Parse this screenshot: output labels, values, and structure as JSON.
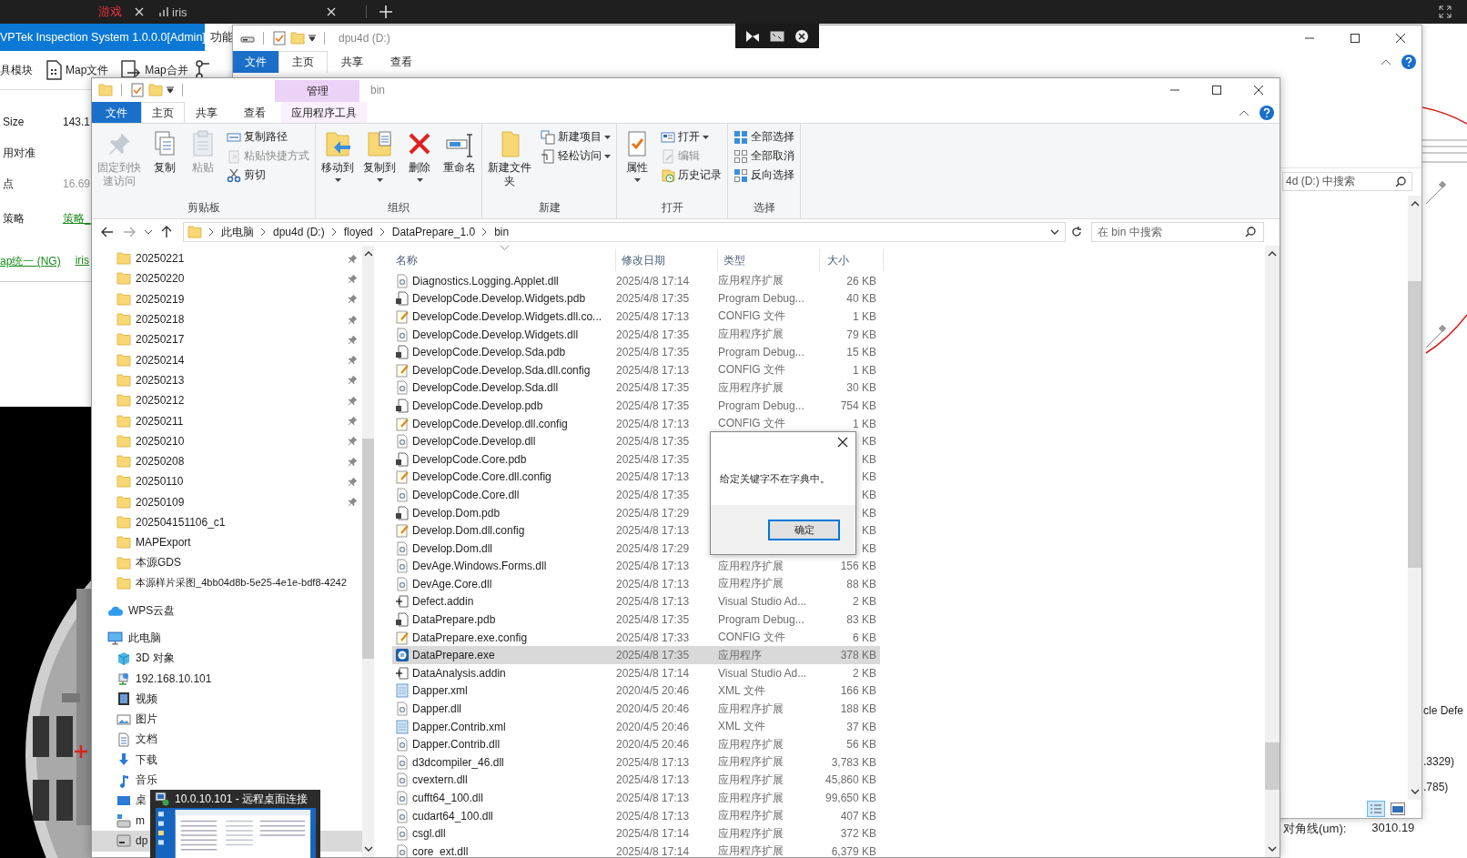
{
  "browser_tabs": [
    {
      "label": "游戏",
      "kind": "plain",
      "color": "#e8343c"
    },
    {
      "label": "iris",
      "kind": "signal",
      "color": "#c8c8c8"
    }
  ],
  "vptek": {
    "title": "VPTek Inspection System 1.0.0.0[Admin]",
    "menu_item": "功能",
    "toolbar": [
      {
        "label": "具模块",
        "kind": "text"
      },
      {
        "label": "Map文件",
        "kind": "map-file"
      },
      {
        "label": "Map合并",
        "kind": "map-merge"
      }
    ],
    "fields": [
      {
        "label": "Size",
        "value": "143.1",
        "kind": "text"
      },
      {
        "label": "用对准"
      },
      {
        "label": "点",
        "value": "16.69",
        "kind": "disabled"
      },
      {
        "label": "策略",
        "value": "策略_",
        "kind": "link"
      }
    ],
    "links": [
      "ap统一 (NG)",
      "iris"
    ],
    "side_texts": [
      "cle Defe",
      ".3329)",
      ".785)"
    ],
    "diagonal": {
      "label": "对角线(um):",
      "value": "3010.19"
    }
  },
  "back_explorer": {
    "title": "dpu4d (D:)",
    "tabs": [
      {
        "label": "文件",
        "kind": "file",
        "selected": false
      },
      {
        "label": "主页",
        "kind": "tab",
        "selected": true
      },
      {
        "label": "共享",
        "kind": "tab",
        "selected": false
      },
      {
        "label": "查看",
        "kind": "tab",
        "selected": false
      }
    ],
    "search_placeholder": "4d (D:) 中搜索"
  },
  "explorer": {
    "title": "bin",
    "tool_group": "管理",
    "tabs": [
      {
        "label": "文件",
        "kind": "file",
        "selected": false
      },
      {
        "label": "主页",
        "kind": "tab",
        "selected": true
      },
      {
        "label": "共享",
        "kind": "tab",
        "selected": false
      },
      {
        "label": "查看",
        "kind": "tab",
        "selected": false
      },
      {
        "label": "应用程序工具",
        "kind": "tool",
        "selected": false
      }
    ],
    "ribbon": [
      {
        "label": "剪贴板",
        "buttons": [
          {
            "label": "固定到快速访问",
            "kind": "large",
            "disabled": true,
            "dropdown": false
          },
          {
            "label": "复制",
            "kind": "large",
            "disabled": false,
            "dropdown": false
          },
          {
            "label": "粘贴",
            "kind": "large",
            "disabled": true,
            "dropdown": false
          },
          {
            "label": "复制路径",
            "kind": "small",
            "disabled": false,
            "dropdown": false
          },
          {
            "label": "粘贴快捷方式",
            "kind": "small",
            "disabled": true,
            "dropdown": false
          },
          {
            "label": "剪切",
            "kind": "small",
            "disabled": false,
            "dropdown": false
          }
        ]
      },
      {
        "label": "组织",
        "buttons": [
          {
            "label": "移动到",
            "kind": "large",
            "disabled": false,
            "dropdown": true
          },
          {
            "label": "复制到",
            "kind": "large",
            "disabled": false,
            "dropdown": true
          },
          {
            "label": "删除",
            "kind": "large",
            "disabled": false,
            "dropdown": true
          },
          {
            "label": "重命名",
            "kind": "large",
            "disabled": false,
            "dropdown": false
          }
        ]
      },
      {
        "label": "新建",
        "buttons": [
          {
            "label": "新建文件夹",
            "kind": "large",
            "disabled": false,
            "dropdown": false
          },
          {
            "label": "新建项目",
            "kind": "small",
            "disabled": false,
            "dropdown": true
          },
          {
            "label": "轻松访问",
            "kind": "small",
            "disabled": false,
            "dropdown": true
          }
        ]
      },
      {
        "label": "打开",
        "buttons": [
          {
            "label": "属性",
            "kind": "large",
            "disabled": false,
            "dropdown": true
          },
          {
            "label": "打开",
            "kind": "small",
            "disabled": false,
            "dropdown": true
          },
          {
            "label": "编辑",
            "kind": "small",
            "disabled": true,
            "dropdown": false
          },
          {
            "label": "历史记录",
            "kind": "small",
            "disabled": false,
            "dropdown": false
          }
        ]
      },
      {
        "label": "选择",
        "buttons": [
          {
            "label": "全部选择",
            "kind": "small",
            "disabled": false,
            "dropdown": false
          },
          {
            "label": "全部取消",
            "kind": "small",
            "disabled": false,
            "dropdown": false
          },
          {
            "label": "反向选择",
            "kind": "small",
            "disabled": false,
            "dropdown": false
          }
        ]
      }
    ],
    "address": [
      "此电脑",
      "dpu4d (D:)",
      "floyed",
      "DataPrepare_1.0",
      "bin"
    ],
    "search_placeholder": "在 bin 中搜索",
    "quick_access": [
      {
        "label": "20250221",
        "pinned": true
      },
      {
        "label": "20250220",
        "pinned": true
      },
      {
        "label": "20250219",
        "pinned": true
      },
      {
        "label": "20250218",
        "pinned": true
      },
      {
        "label": "20250217",
        "pinned": true
      },
      {
        "label": "20250214",
        "pinned": true
      },
      {
        "label": "20250213",
        "pinned": true
      },
      {
        "label": "20250212",
        "pinned": true
      },
      {
        "label": "20250211",
        "pinned": true
      },
      {
        "label": "20250210",
        "pinned": true
      },
      {
        "label": "20250208",
        "pinned": true
      },
      {
        "label": "20250110",
        "pinned": true
      },
      {
        "label": "20250109",
        "pinned": true
      },
      {
        "label": "202504151106_c1",
        "pinned": false
      },
      {
        "label": "MAPExport",
        "pinned": false
      },
      {
        "label": "本源GDS",
        "pinned": false
      },
      {
        "label": "本源样片采图_4bb04d8b-5e25-4e1e-bdf8-4242",
        "pinned": false
      }
    ],
    "roots": [
      {
        "label": "WPS云盘",
        "kind": "cloud",
        "selected": false
      },
      {
        "label": "此电脑",
        "kind": "computer",
        "selected": false,
        "children": [
          {
            "label": "3D 对象",
            "kind": "cube",
            "selected": false
          },
          {
            "label": "192.168.10.101",
            "kind": "network",
            "selected": false
          },
          {
            "label": "视频",
            "kind": "video",
            "selected": false
          },
          {
            "label": "图片",
            "kind": "picture",
            "selected": false
          },
          {
            "label": "文档",
            "kind": "document",
            "selected": false
          },
          {
            "label": "下载",
            "kind": "download",
            "selected": false
          },
          {
            "label": "音乐",
            "kind": "music",
            "selected": false
          },
          {
            "label": "桌",
            "kind": "desktop",
            "selected": false
          },
          {
            "label": "m",
            "kind": "netdrive",
            "selected": false
          },
          {
            "label": "dp",
            "kind": "drive",
            "selected": true
          }
        ]
      }
    ],
    "columns": [
      "名称",
      "修改日期",
      "类型",
      "大小"
    ],
    "rows": [
      {
        "name": "Diagnostics.Logging.Applet.dll",
        "date": "2025/4/8 17:14",
        "type": "应用程序扩展",
        "size": "26 KB",
        "kind": "dll",
        "selected": false
      },
      {
        "name": "DevelopCode.Develop.Widgets.pdb",
        "date": "2025/4/8 17:35",
        "type": "Program Debug...",
        "size": "40 KB",
        "kind": "pdb",
        "selected": false
      },
      {
        "name": "DevelopCode.Develop.Widgets.dll.co...",
        "date": "2025/4/8 17:13",
        "type": "CONFIG 文件",
        "size": "1 KB",
        "kind": "config",
        "selected": false
      },
      {
        "name": "DevelopCode.Develop.Widgets.dll",
        "date": "2025/4/8 17:35",
        "type": "应用程序扩展",
        "size": "79 KB",
        "kind": "dll",
        "selected": false
      },
      {
        "name": "DevelopCode.Develop.Sda.pdb",
        "date": "2025/4/8 17:35",
        "type": "Program Debug...",
        "size": "15 KB",
        "kind": "pdb",
        "selected": false
      },
      {
        "name": "DevelopCode.Develop.Sda.dll.config",
        "date": "2025/4/8 17:13",
        "type": "CONFIG 文件",
        "size": "1 KB",
        "kind": "config",
        "selected": false
      },
      {
        "name": "DevelopCode.Develop.Sda.dll",
        "date": "2025/4/8 17:35",
        "type": "应用程序扩展",
        "size": "30 KB",
        "kind": "dll",
        "selected": false
      },
      {
        "name": "DevelopCode.Develop.pdb",
        "date": "2025/4/8 17:35",
        "type": "Program Debug...",
        "size": "754 KB",
        "kind": "pdb",
        "selected": false
      },
      {
        "name": "DevelopCode.Develop.dll.config",
        "date": "2025/4/8 17:13",
        "type": "CONFIG 文件",
        "size": "1 KB",
        "kind": "config",
        "selected": false
      },
      {
        "name": "DevelopCode.Develop.dll",
        "date": "2025/4/8 17:35",
        "size": "KB",
        "kind": "dll",
        "selected": false
      },
      {
        "name": "DevelopCode.Core.pdb",
        "date": "2025/4/8 17:35",
        "size": "KB",
        "kind": "pdb",
        "selected": false
      },
      {
        "name": "DevelopCode.Core.dll.config",
        "date": "2025/4/8 17:13",
        "size": "KB",
        "kind": "config",
        "selected": false
      },
      {
        "name": "DevelopCode.Core.dll",
        "date": "2025/4/8 17:35",
        "size": "KB",
        "kind": "dll",
        "selected": false
      },
      {
        "name": "Develop.Dom.pdb",
        "date": "2025/4/8 17:29",
        "size": "KB",
        "kind": "pdb",
        "selected": false
      },
      {
        "name": "Develop.Dom.dll.config",
        "date": "2025/4/8 17:13",
        "size": "KB",
        "kind": "config",
        "selected": false
      },
      {
        "name": "Develop.Dom.dll",
        "date": "2025/4/8 17:29",
        "size": "KB",
        "kind": "dll",
        "selected": false
      },
      {
        "name": "DevAge.Windows.Forms.dll",
        "date": "2025/4/8 17:13",
        "type": "应用程序扩展",
        "size": "156 KB",
        "kind": "dll",
        "selected": false
      },
      {
        "name": "DevAge.Core.dll",
        "date": "2025/4/8 17:13",
        "type": "应用程序扩展",
        "size": "88 KB",
        "kind": "dll",
        "selected": false
      },
      {
        "name": "Defect.addin",
        "date": "2025/4/8 17:13",
        "type": "Visual Studio Ad...",
        "size": "2 KB",
        "kind": "addin",
        "selected": false
      },
      {
        "name": "DataPrepare.pdb",
        "date": "2025/4/8 17:35",
        "type": "Program Debug...",
        "size": "83 KB",
        "kind": "pdb",
        "selected": false
      },
      {
        "name": "DataPrepare.exe.config",
        "date": "2025/4/8 17:33",
        "type": "CONFIG 文件",
        "size": "6 KB",
        "kind": "config",
        "selected": false
      },
      {
        "name": "DataPrepare.exe",
        "date": "2025/4/8 17:35",
        "type": "应用程序",
        "size": "378 KB",
        "kind": "exe",
        "selected": true
      },
      {
        "name": "DataAnalysis.addin",
        "date": "2025/4/8 17:14",
        "type": "Visual Studio Ad...",
        "size": "2 KB",
        "kind": "addin",
        "selected": false
      },
      {
        "name": "Dapper.xml",
        "date": "2020/4/5 20:46",
        "type": "XML 文件",
        "size": "166 KB",
        "kind": "xml",
        "selected": false
      },
      {
        "name": "Dapper.dll",
        "date": "2020/4/5 20:46",
        "type": "应用程序扩展",
        "size": "188 KB",
        "kind": "dll",
        "selected": false
      },
      {
        "name": "Dapper.Contrib.xml",
        "date": "2020/4/5 20:46",
        "type": "XML 文件",
        "size": "37 KB",
        "kind": "xml",
        "selected": false
      },
      {
        "name": "Dapper.Contrib.dll",
        "date": "2020/4/5 20:46",
        "type": "应用程序扩展",
        "size": "56 KB",
        "kind": "dll",
        "selected": false
      },
      {
        "name": "d3dcompiler_46.dll",
        "date": "2025/4/8 17:13",
        "type": "应用程序扩展",
        "size": "3,783 KB",
        "kind": "dll",
        "selected": false
      },
      {
        "name": "cvextern.dll",
        "date": "2025/4/8 17:13",
        "type": "应用程序扩展",
        "size": "45,860 KB",
        "kind": "dll",
        "selected": false
      },
      {
        "name": "cufft64_100.dll",
        "date": "2025/4/8 17:13",
        "type": "应用程序扩展",
        "size": "99,650 KB",
        "kind": "dll",
        "selected": false
      },
      {
        "name": "cudart64_100.dll",
        "date": "2025/4/8 17:13",
        "type": "应用程序扩展",
        "size": "407 KB",
        "kind": "dll",
        "selected": false
      },
      {
        "name": "csgl.dll",
        "date": "2025/4/8 17:14",
        "type": "应用程序扩展",
        "size": "372 KB",
        "kind": "dll",
        "selected": false
      },
      {
        "name": "core_ext.dll",
        "date": "2025/4/8 17:14",
        "type": "应用程序扩展",
        "size": "6,379 KB",
        "kind": "dll",
        "selected": false
      }
    ]
  },
  "dialog": {
    "message": "给定关键字不在字典中。",
    "button": "确定"
  },
  "taskbar_preview": {
    "title": "10.0.10.101 - 远程桌面连接"
  }
}
